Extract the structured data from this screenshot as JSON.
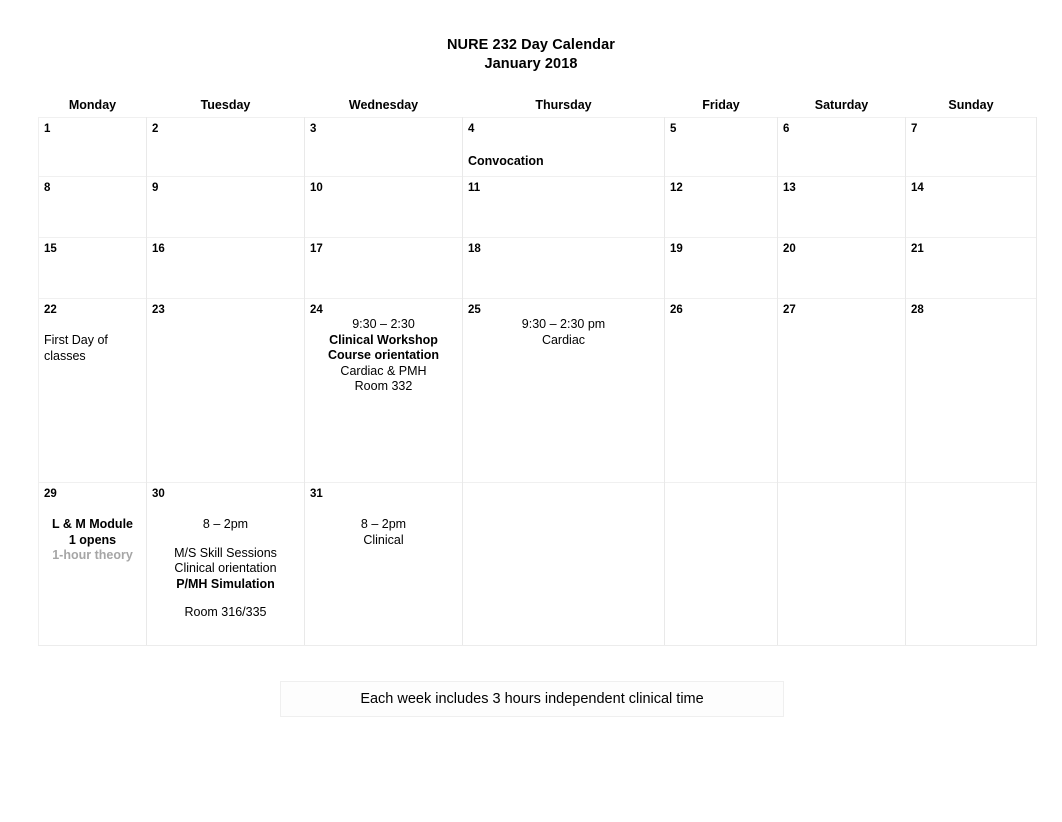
{
  "document": {
    "title_line_1": "NURE 232 Day Calendar",
    "title_line_2": "January 2018"
  },
  "calendar": {
    "day_headers": [
      "Monday",
      "Tuesday",
      "Wednesday",
      "Thursday",
      "Friday",
      "Saturday",
      "Sunday"
    ],
    "weeks": [
      {
        "days": [
          {
            "num": "1",
            "events": []
          },
          {
            "num": "2",
            "events": []
          },
          {
            "num": "3",
            "events": []
          },
          {
            "num": "4",
            "align": "left",
            "events": [
              {
                "text": "Convocation",
                "style": "bold",
                "gap": "gap-top-18"
              }
            ]
          },
          {
            "num": "5",
            "events": []
          },
          {
            "num": "6",
            "events": []
          },
          {
            "num": "7",
            "events": []
          }
        ]
      },
      {
        "days": [
          {
            "num": "8",
            "events": []
          },
          {
            "num": "9",
            "events": []
          },
          {
            "num": "10",
            "events": []
          },
          {
            "num": "11",
            "events": []
          },
          {
            "num": "12",
            "events": []
          },
          {
            "num": "13",
            "events": []
          },
          {
            "num": "14",
            "events": []
          }
        ]
      },
      {
        "days": [
          {
            "num": "15",
            "events": []
          },
          {
            "num": "16",
            "events": []
          },
          {
            "num": "17",
            "events": []
          },
          {
            "num": "18",
            "events": []
          },
          {
            "num": "19",
            "events": []
          },
          {
            "num": "20",
            "events": []
          },
          {
            "num": "21",
            "events": []
          }
        ]
      },
      {
        "days": [
          {
            "num": "22",
            "align": "left",
            "events": [
              {
                "text": "First Day of",
                "style": "normal",
                "gap": "gap-top-16"
              },
              {
                "text": "classes",
                "style": "normal"
              }
            ]
          },
          {
            "num": "23",
            "events": []
          },
          {
            "num": "24",
            "align": "centered",
            "events": [
              {
                "text": "9:30 – 2:30",
                "style": "normal"
              },
              {
                "text": "Clinical Workshop",
                "style": "bold"
              },
              {
                "text": "Course orientation",
                "style": "bold"
              },
              {
                "text": "Cardiac & PMH",
                "style": "normal"
              },
              {
                "text": "Room 332",
                "style": "normal"
              }
            ]
          },
          {
            "num": "25",
            "align": "centered",
            "events": [
              {
                "text": "9:30 – 2:30 pm",
                "style": "normal"
              },
              {
                "text": "Cardiac",
                "style": "normal"
              }
            ]
          },
          {
            "num": "26",
            "events": []
          },
          {
            "num": "27",
            "events": []
          },
          {
            "num": "28",
            "events": []
          }
        ]
      },
      {
        "days": [
          {
            "num": "29",
            "align": "centered",
            "events": [
              {
                "text": "L & M Module",
                "style": "bold",
                "gap": "gap-top-16"
              },
              {
                "text": "1 opens",
                "style": "bold"
              },
              {
                "text": "1-hour theory",
                "style": "gray"
              }
            ]
          },
          {
            "num": "30",
            "align": "centered",
            "events": [
              {
                "text": "8 – 2pm",
                "style": "normal",
                "gap": "gap-top-16"
              },
              {
                "text": "",
                "style": "spacer"
              },
              {
                "text": "M/S Skill Sessions",
                "style": "normal"
              },
              {
                "text": "Clinical orientation",
                "style": "normal"
              },
              {
                "text": "P/MH Simulation",
                "style": "bold"
              },
              {
                "text": "",
                "style": "spacer"
              },
              {
                "text": "Room 316/335",
                "style": "normal"
              }
            ]
          },
          {
            "num": "31",
            "align": "centered",
            "events": [
              {
                "text": "8 – 2pm",
                "style": "normal",
                "gap": "gap-top-16"
              },
              {
                "text": "Clinical",
                "style": "normal"
              }
            ]
          },
          {
            "num": "",
            "events": []
          },
          {
            "num": "",
            "events": []
          },
          {
            "num": "",
            "events": []
          },
          {
            "num": "",
            "events": []
          }
        ]
      }
    ]
  },
  "footer": {
    "note": "Each week includes 3 hours independent clinical time"
  }
}
